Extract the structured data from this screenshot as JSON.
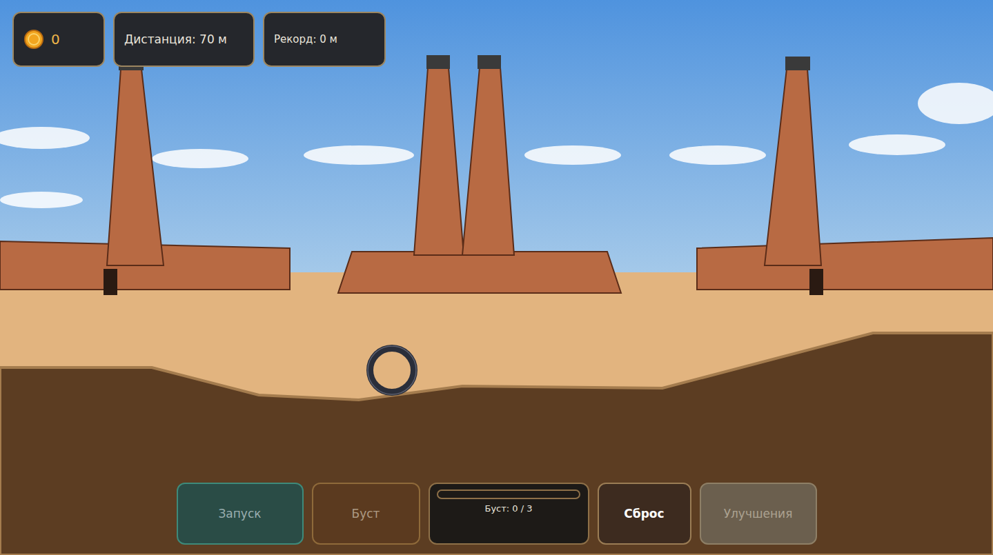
{
  "hud": {
    "coins": "0",
    "distance": "Дистанция: 70 м",
    "record": "Рекорд: 0 м"
  },
  "buttons": [
    {
      "label": "Запуск",
      "disabled": true
    },
    {
      "label": "Буст",
      "disabled": true
    },
    {
      "label": "Сброс",
      "disabled": false
    },
    {
      "label": "Улучшения",
      "disabled": true
    }
  ],
  "boost_meter": {
    "label": "Буст: 0 / 3",
    "level": 0
  }
}
